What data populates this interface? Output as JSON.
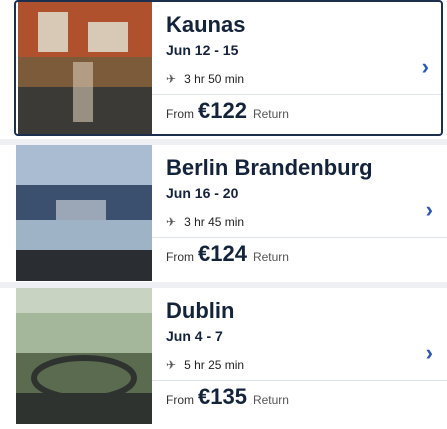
{
  "results": [
    {
      "city": "Kaunas",
      "dates": "Jun 12 - 15",
      "duration": "3 hr 50 min",
      "from_label": "From",
      "price": "€122",
      "return_label": "Return",
      "image_colors": [
        "#b0512e",
        "#7b5b3a",
        "#d7c9b5",
        "#3c3a36"
      ]
    },
    {
      "city": "Berlin Brandenburg",
      "dates": "Jun 16 - 20",
      "duration": "3 hr 45 min",
      "from_label": "From",
      "price": "€124",
      "return_label": "Return",
      "image_colors": [
        "#6f8fb5",
        "#3b4f6e",
        "#9fb3c7",
        "#2a2d31"
      ]
    },
    {
      "city": "Dublin",
      "dates": "Jun 4 - 7",
      "duration": "5 hr 25 min",
      "from_label": "From",
      "price": "€135",
      "return_label": "Return",
      "image_colors": [
        "#a5b79a",
        "#5b6b4f",
        "#8d8e86",
        "#2f332f"
      ]
    }
  ],
  "icons": {
    "plane": "plane-icon",
    "chevron": "chevron-right-icon"
  }
}
